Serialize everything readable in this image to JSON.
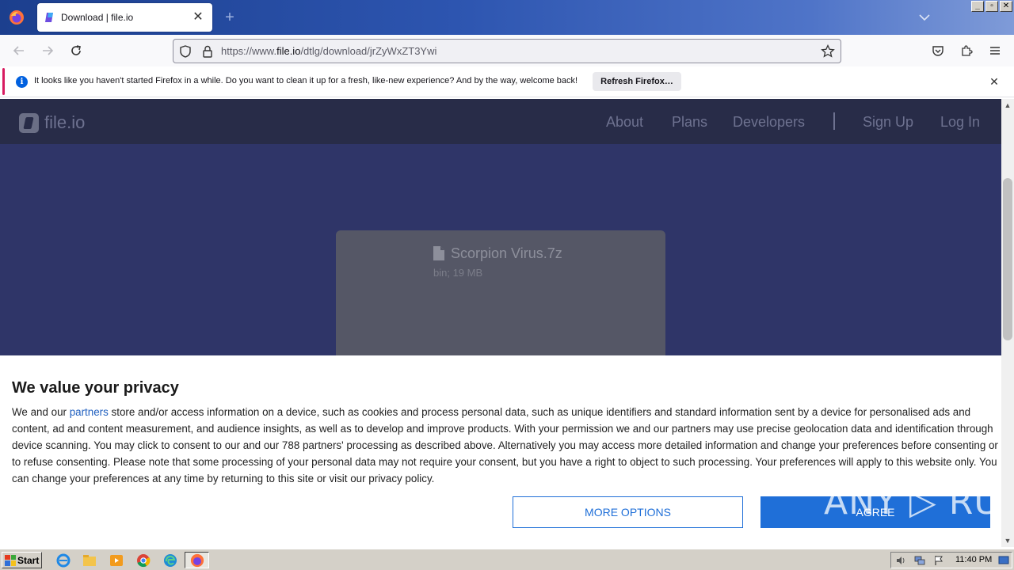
{
  "browser": {
    "tab": {
      "title": "Download | file.io",
      "close": "✕"
    },
    "new_tab": "+",
    "url": {
      "prefix": "https://www.",
      "domain": "file.io",
      "path": "/dtlg/download/jrZyWxZT3Ywi"
    },
    "window_buttons": [
      "_",
      "▫",
      "✕"
    ]
  },
  "notification": {
    "text": "It looks like you haven't started Firefox in a while. Do you want to clean it up for a fresh, like-new experience? And by the way, welcome back!",
    "button": "Refresh Firefox…",
    "close": "✕",
    "info": "i"
  },
  "site": {
    "logo": "file.io",
    "nav": {
      "about": "About",
      "plans": "Plans",
      "developers": "Developers",
      "signup": "Sign Up",
      "login": "Log In"
    }
  },
  "file": {
    "name": "Scorpion Virus.7z",
    "meta": "bin; 19 MB"
  },
  "consent": {
    "title": "We value your privacy",
    "text_before": "We and our ",
    "link": "partners",
    "text_after": " store and/or access information on a device, such as cookies and process personal data, such as unique identifiers and standard information sent by a device for personalised ads and content, ad and content measurement, and audience insights, as well as to develop and improve products. With your permission we and our partners may use precise geolocation data and identification through device scanning. You may click to consent to our and our 788 partners' processing as described above. Alternatively you may access more detailed information and change your preferences before consenting or to refuse consenting. Please note that some processing of your personal data may not require your consent, but you have a right to object to such processing. Your preferences will apply to this website only. You can change your preferences at any time by returning to this site or visit our privacy policy.",
    "more_options": "MORE OPTIONS",
    "agree": "AGREE"
  },
  "watermark": "ANY ▷ RUN",
  "taskbar": {
    "start": "Start",
    "clock": "11:40 PM"
  },
  "scrollbar": {
    "up": "▲",
    "down": "▼"
  },
  "colors": {
    "page_bg": "#2f3568",
    "header_bg": "#282c48",
    "primary": "#1f6fd8",
    "link": "#1f5fbf"
  }
}
